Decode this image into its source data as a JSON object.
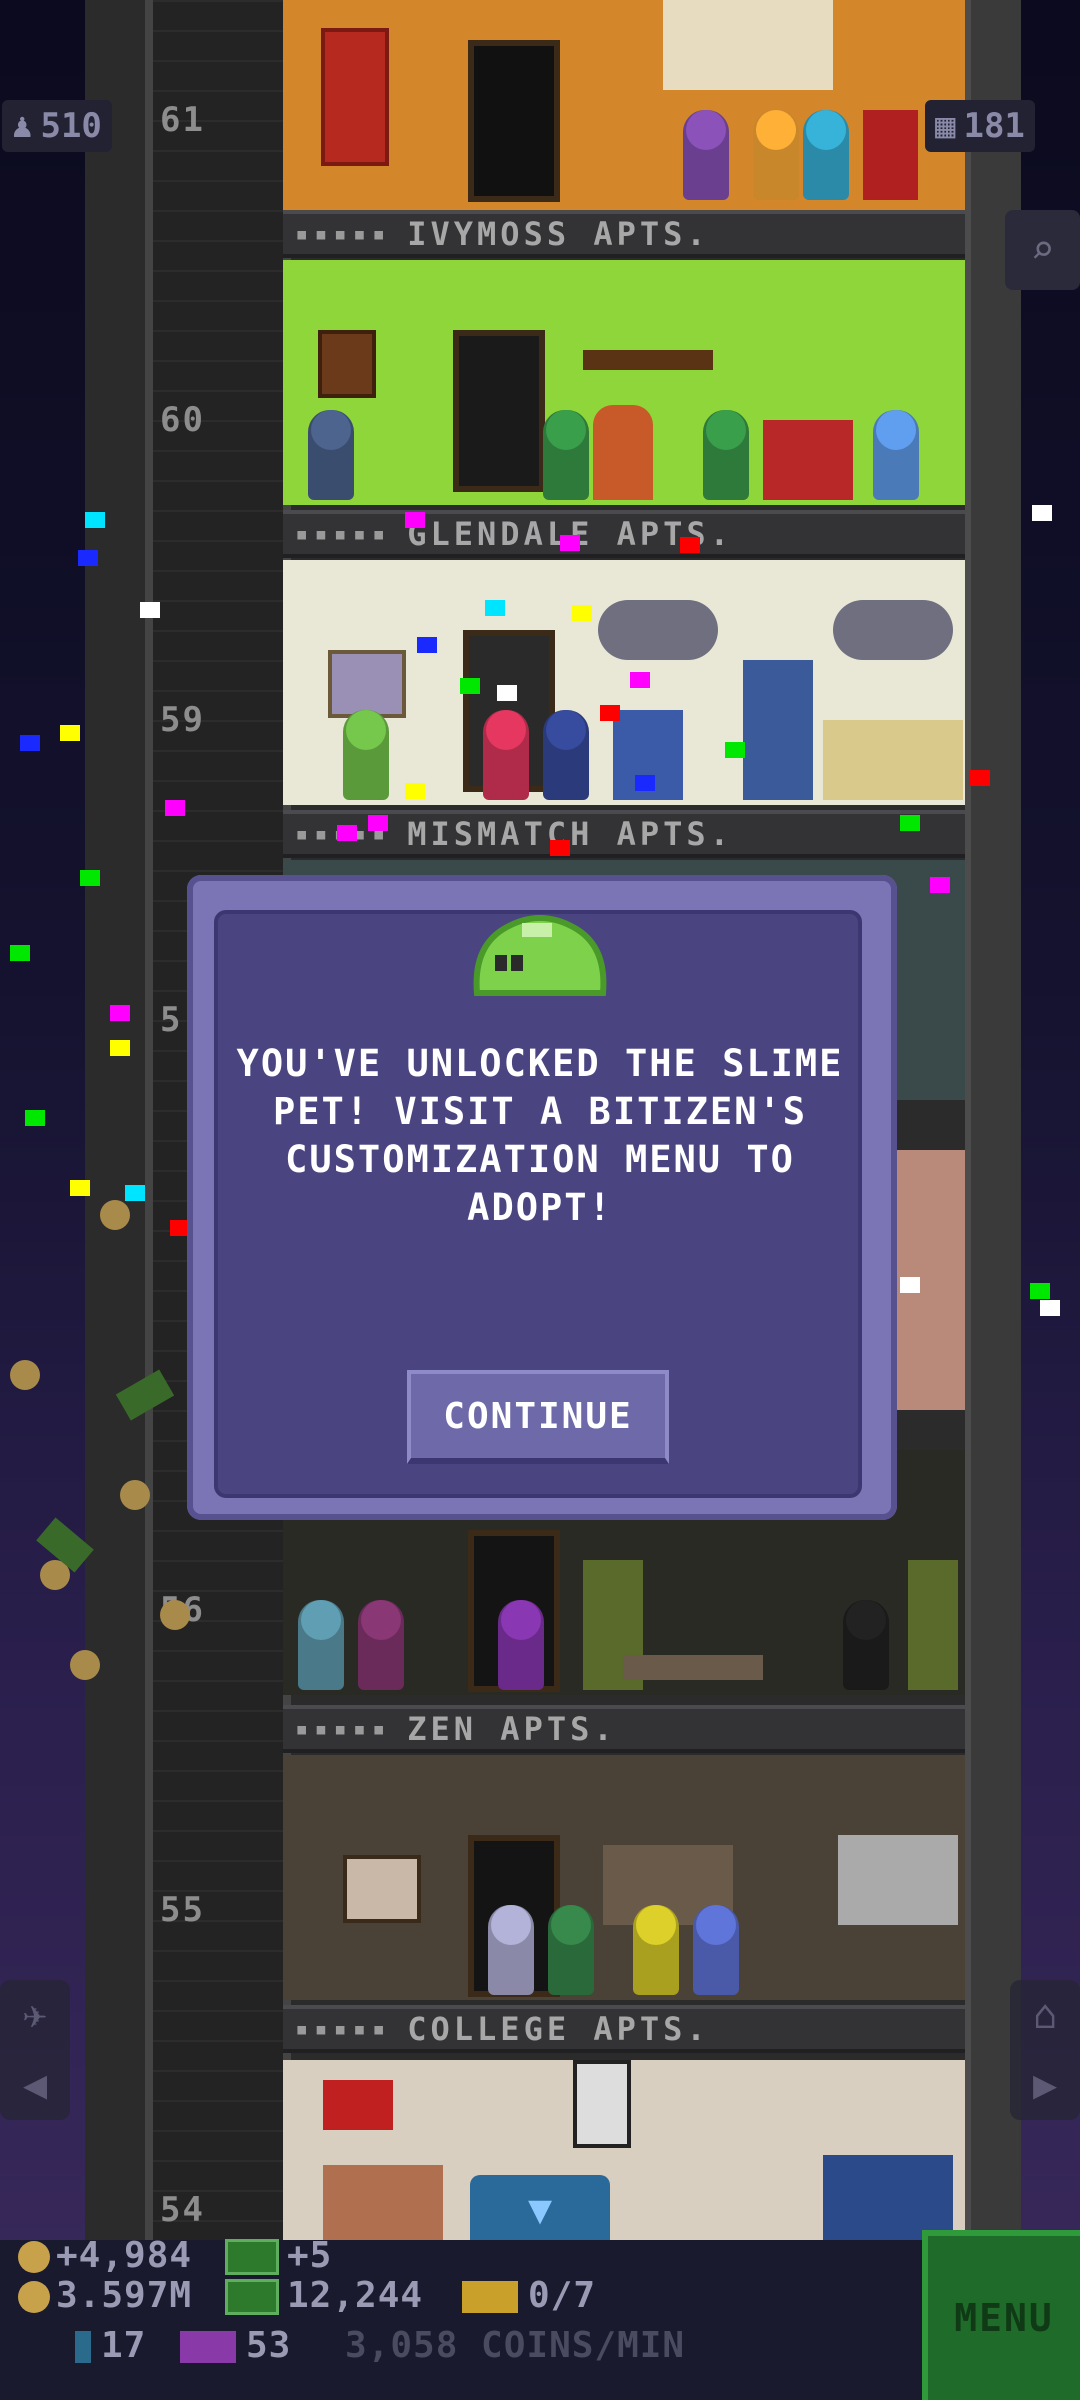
{
  "hud": {
    "population": "510",
    "floors_count": "181"
  },
  "floors": [
    {
      "number": "61",
      "name": "IVYMOSS APTS."
    },
    {
      "number": "60",
      "name": "GLENDALE APTS."
    },
    {
      "number": "59",
      "name": "MISMATCH APTS."
    },
    {
      "number": "5",
      "name": ""
    },
    {
      "number": "56",
      "name": "ZEN APTS."
    },
    {
      "number": "55",
      "name": "COLLEGE APTS."
    },
    {
      "number": "54",
      "name": ""
    }
  ],
  "dialog": {
    "message": "YOU'VE UNLOCKED THE SLIME PET! VISIT A BITIZEN'S CUSTOMIZATION MENU TO ADOPT!",
    "continue_label": "CONTINUE"
  },
  "bottom_bar": {
    "coins_gain": "+4,984",
    "coins_total": "3.597M",
    "bux_gain": "+5",
    "bux_total": "12,244",
    "tickets": "0/7",
    "elevator_stat": "17",
    "tv_stat": "53",
    "rate": "3,058 COINS/MIN",
    "menu_label": "MENU"
  },
  "colors": {
    "dialog_outer": "#7b75b6",
    "dialog_inner": "#4a4580",
    "menu_green": "#1f6b2a"
  },
  "icons": [
    "population-icon",
    "floors-icon",
    "search-icon",
    "slime-pet-icon",
    "coin-icon",
    "bux-icon",
    "ticket-icon",
    "elevator-icon",
    "tv-icon",
    "down-arrow-icon",
    "lift-icon",
    "home-icon"
  ]
}
